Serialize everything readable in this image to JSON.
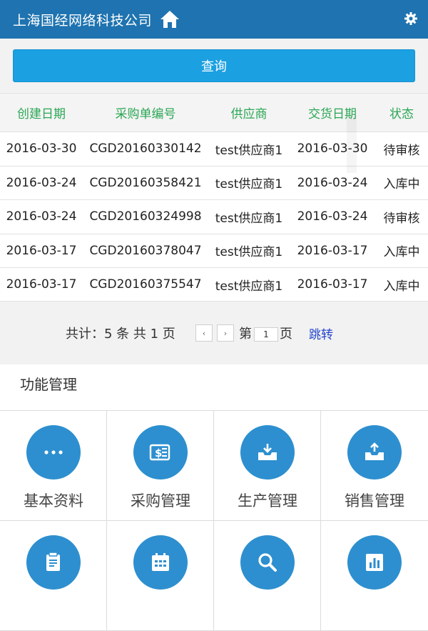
{
  "header": {
    "title": "上海国经网络科技公司",
    "home_icon": "home-icon",
    "settings_icon": "gear-icon"
  },
  "query": {
    "button_label": "查询"
  },
  "table": {
    "columns": [
      "创建日期",
      "采购单编号",
      "供应商",
      "交货日期",
      "状态"
    ],
    "rows": [
      [
        "2016-03-30",
        "CGD20160330142",
        "test供应商1",
        "2016-03-30",
        "待审核"
      ],
      [
        "2016-03-24",
        "CGD20160358421",
        "test供应商1",
        "2016-03-24",
        "入库中"
      ],
      [
        "2016-03-24",
        "CGD20160324998",
        "test供应商1",
        "2016-03-24",
        "待审核"
      ],
      [
        "2016-03-17",
        "CGD20160378047",
        "test供应商1",
        "2016-03-17",
        "入库中"
      ],
      [
        "2016-03-17",
        "CGD20160375547",
        "test供应商1",
        "2016-03-17",
        "入库中"
      ]
    ]
  },
  "pager": {
    "total_text": "共计：5 条 共 1 页",
    "prev_symbol": "‹",
    "next_symbol": "›",
    "page_prefix": "第",
    "page_value": "1",
    "page_suffix": "页",
    "jump_label": "跳转"
  },
  "functions": {
    "title": "功能管理",
    "items": [
      {
        "label": "基本资料",
        "icon": "more-dots-icon"
      },
      {
        "label": "采购管理",
        "icon": "purchase-bill-icon"
      },
      {
        "label": "生产管理",
        "icon": "tray-in-icon"
      },
      {
        "label": "销售管理",
        "icon": "tray-out-icon"
      },
      {
        "label": "",
        "icon": "document-edit-icon"
      },
      {
        "label": "",
        "icon": "calendar-icon"
      },
      {
        "label": "",
        "icon": "search-icon"
      },
      {
        "label": "",
        "icon": "bar-chart-icon"
      }
    ]
  },
  "colors": {
    "header_bg": "#1e73b0",
    "button_bg": "#1ba0e2",
    "column_header_text": "#2aa654",
    "icon_circle": "#2d8fcf"
  }
}
